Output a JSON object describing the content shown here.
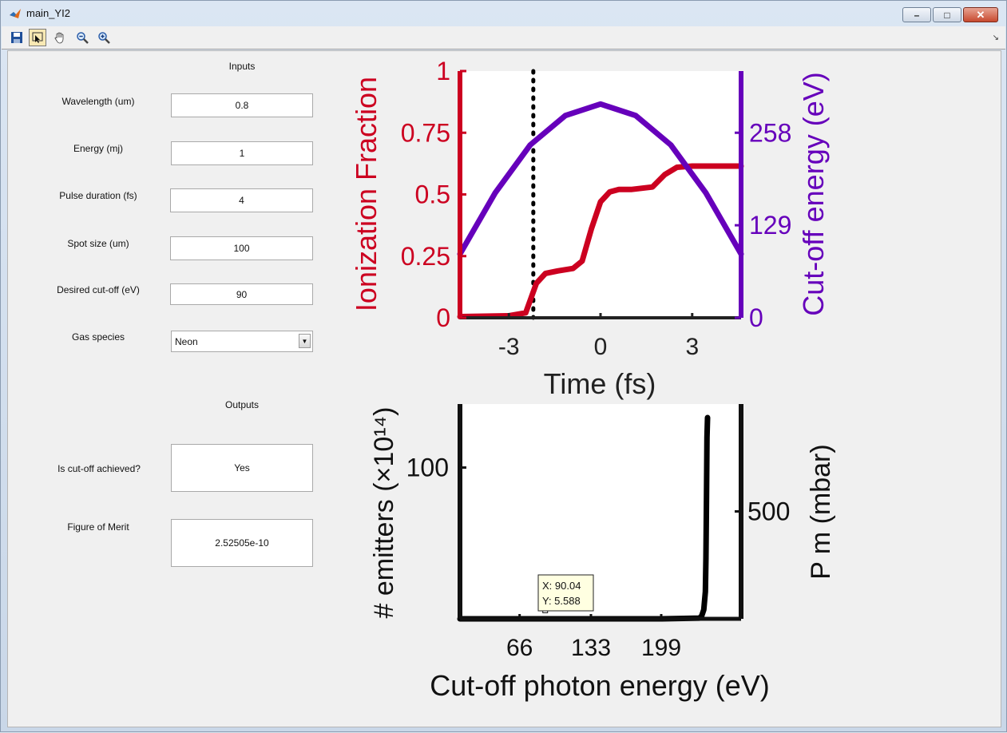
{
  "window": {
    "title": "main_YI2",
    "minimize": "–",
    "maximize": "□",
    "close": "✕"
  },
  "toolbar": {
    "icons": [
      "save-icon",
      "data-cursor-icon",
      "pan-hand-icon",
      "zoom-out-icon",
      "zoom-in-icon"
    ],
    "dock": "↘"
  },
  "inputs": {
    "heading": "Inputs",
    "wavelength": {
      "label": "Wavelength (um)",
      "value": "0.8"
    },
    "energy": {
      "label": "Energy (mj)",
      "value": "1"
    },
    "pulse": {
      "label": "Pulse duration (fs)",
      "value": "4"
    },
    "spot": {
      "label": "Spot size (um)",
      "value": "100"
    },
    "cutoff": {
      "label": "Desired cut-off (eV)",
      "value": "90"
    },
    "gas": {
      "label": "Gas species",
      "value": "Neon",
      "arrow": "▼"
    }
  },
  "outputs": {
    "heading": "Outputs",
    "achieved": {
      "label": "Is cut-off achieved?",
      "value": "Yes"
    },
    "merit": {
      "label": "Figure of Merit",
      "value": "2.52505e-10"
    }
  },
  "colors": {
    "red": "#cc0020",
    "purple": "#6600bb",
    "black": "#000000"
  },
  "chart_data": [
    {
      "type": "line",
      "xlabel": "Time (fs)",
      "ylabel": "Ionization Fraction",
      "ylabel_right": "Cut-off energy (eV)",
      "xlim": [
        -4.6,
        4.6
      ],
      "ylim": [
        0,
        1
      ],
      "ylim_right": [
        0,
        344
      ],
      "xticks": [
        "-3",
        "0",
        "3"
      ],
      "yticks_left": [
        "0",
        "0.25",
        "0.5",
        "0.75",
        "1"
      ],
      "yticks_right": [
        "0",
        "129",
        "258"
      ],
      "vline_x": -2.2,
      "series": [
        {
          "axis": "left",
          "x": [
            -4.6,
            -3.0,
            -2.45,
            -2.1,
            -1.8,
            -1.4,
            -0.9,
            -0.6,
            -0.3,
            0.0,
            0.3,
            0.6,
            1.0,
            1.7,
            2.1,
            2.5,
            3.0,
            4.6
          ],
          "values": [
            0.005,
            0.008,
            0.02,
            0.14,
            0.18,
            0.19,
            0.2,
            0.23,
            0.36,
            0.47,
            0.51,
            0.52,
            0.52,
            0.53,
            0.58,
            0.61,
            0.615,
            0.615
          ]
        },
        {
          "axis": "right",
          "x": [
            -4.6,
            -3.45,
            -2.3,
            -1.15,
            0.0,
            1.15,
            2.3,
            3.45,
            4.6
          ],
          "values": [
            89,
            174,
            241,
            282,
            298,
            282,
            241,
            174,
            89
          ]
        }
      ]
    },
    {
      "type": "line",
      "xlabel": "Cut-off photon energy (eV)",
      "ylabel": "# emitters (×10¹⁴)",
      "ylabel_right": "P m (mbar)",
      "xlim": [
        10,
        274
      ],
      "ylim": [
        0,
        142
      ],
      "ylim_right": [
        0,
        1000
      ],
      "xticks": [
        "66",
        "133",
        "199"
      ],
      "yticks_left": [
        "100"
      ],
      "yticks_right": [
        "500"
      ],
      "series": [
        {
          "x": [
            10,
            120,
            200,
            235,
            237,
            239,
            240.5,
            241,
            241.5,
            242,
            242.5
          ],
          "values": [
            0,
            0,
            0,
            0.5,
            2,
            6,
            18,
            40,
            80,
            120,
            133
          ]
        }
      ],
      "datatip": {
        "x": 90.04,
        "y": 5.588,
        "text_x": "X: 90.04",
        "text_y": "Y: 5.588"
      }
    }
  ]
}
